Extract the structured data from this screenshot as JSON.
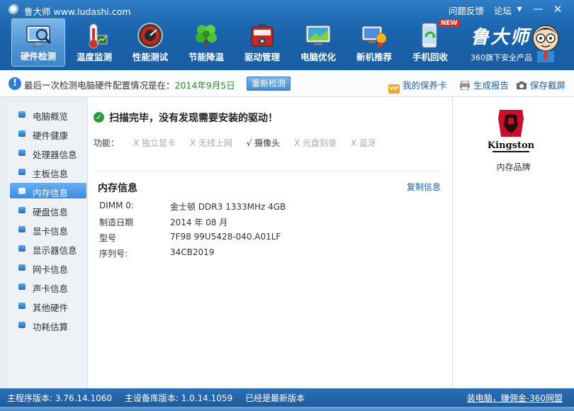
{
  "app": {
    "title": "鲁大师 www.ludashi.com",
    "title_links": [
      "问题反馈",
      "论坛"
    ]
  },
  "toolbar": {
    "items": [
      {
        "label": "硬件检测",
        "icon": "magnifier-monitor-icon",
        "active": true
      },
      {
        "label": "温度监测",
        "icon": "thermometer-icon",
        "active": false
      },
      {
        "label": "性能测试",
        "icon": "speedometer-icon",
        "active": false
      },
      {
        "label": "节能降温",
        "icon": "clover-icon",
        "active": false
      },
      {
        "label": "驱动管理",
        "icon": "toolbox-icon",
        "active": false
      },
      {
        "label": "电脑优化",
        "icon": "monitor-optimize-icon",
        "active": false
      },
      {
        "label": "新机推荐",
        "icon": "badge-monitor-icon",
        "active": false
      },
      {
        "label": "手机回收",
        "icon": "phone-recycle-icon",
        "active": false,
        "badge": "NEW"
      }
    ]
  },
  "brand": {
    "name": "鲁大师",
    "sub": "360旗下安全产品"
  },
  "infobar": {
    "text": "最后一次检测电脑硬件配置情况是在：",
    "date": "2014年9月5日",
    "recheck": "重新检测",
    "vip_badge": "VIP",
    "links": {
      "vip": "我的保养卡",
      "report": "生成报告",
      "save": "保存截屏"
    }
  },
  "sidebar": {
    "items": [
      {
        "label": "电脑概览"
      },
      {
        "label": "硬件健康"
      },
      {
        "label": "处理器信息"
      },
      {
        "label": "主板信息"
      },
      {
        "label": "内存信息",
        "active": true
      },
      {
        "label": "硬盘信息"
      },
      {
        "label": "显卡信息"
      },
      {
        "label": "显示器信息"
      },
      {
        "label": "网卡信息"
      },
      {
        "label": "声卡信息"
      },
      {
        "label": "其他硬件"
      },
      {
        "label": "功耗估算"
      }
    ]
  },
  "main": {
    "scan_message": "扫描完毕，没有发现需要安装的驱动！",
    "features_label": "功能：",
    "features": [
      {
        "mark": "X",
        "label": "独立显卡",
        "on": false
      },
      {
        "mark": "X",
        "label": "无线上网",
        "on": false
      },
      {
        "mark": "√",
        "label": "摄像头",
        "on": true
      },
      {
        "mark": "X",
        "label": "光盘刻录",
        "on": false
      },
      {
        "mark": "X",
        "label": "蓝牙",
        "on": false
      }
    ],
    "section_title": "内存信息",
    "copy_label": "复制信息",
    "rows": [
      {
        "key": "DIMM 0:",
        "value": "金士顿 DDR3 1333MHz 4GB"
      },
      {
        "key": "制造日期",
        "value": "2014 年 08 月"
      },
      {
        "key": "型号",
        "value": "7F98 99U5428-040.A01LF"
      },
      {
        "key": "序列号:",
        "value": "34CB2019"
      }
    ]
  },
  "right_panel": {
    "logo_text": "Kingston",
    "caption": "内存品牌"
  },
  "statusbar": {
    "main_version": "主程序版本: 3.76.14.1060",
    "db_version": "主设备库版本: 1.0.14.1059",
    "latest": "已经是最新版本",
    "link": "装电脑，赚佣金-360网盟"
  },
  "colors": {
    "title_blue": "#1f6ab3",
    "accent": "#3a8ae0",
    "link": "#1d5fa8",
    "date_green": "#2e8b2e",
    "check_green": "#2b9a3c",
    "kingston_red": "#c8102e"
  }
}
